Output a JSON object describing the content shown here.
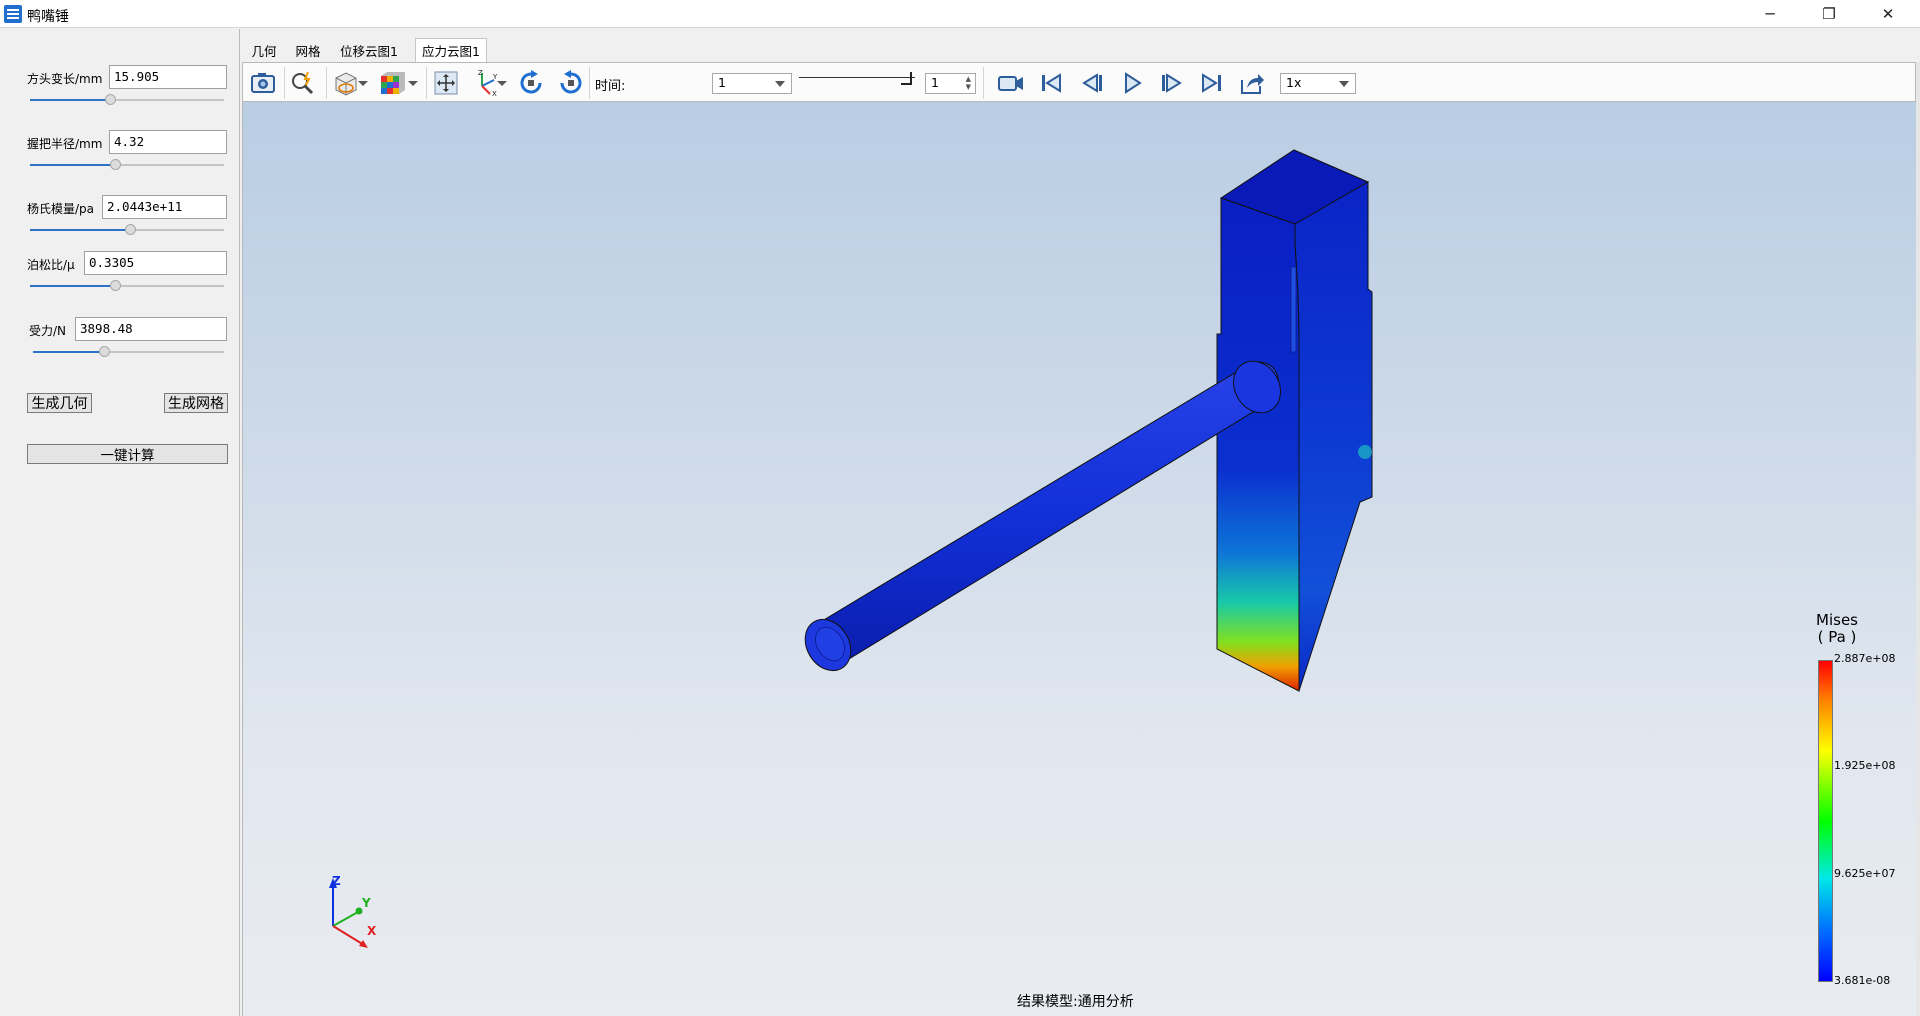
{
  "window": {
    "title": "鸭嘴锤",
    "min_glyph": "─",
    "max_glyph": "❐",
    "close_glyph": "✕"
  },
  "params": [
    {
      "label": "方头变长/mm",
      "value": "15.905",
      "slider_fraction": 0.45
    },
    {
      "label": "握把半径/mm",
      "value": "4.32",
      "slider_fraction": 0.45
    },
    {
      "label": "杨氏模量/pa",
      "value": "2.0443e+11",
      "slider_fraction": 0.52
    },
    {
      "label": "泊松比/μ",
      "value": "0.3305",
      "slider_fraction": 0.45
    },
    {
      "label": "受力/N",
      "value": "3898.48",
      "slider_fraction": 0.38
    }
  ],
  "buttons": {
    "gen_geometry": "生成几何",
    "gen_mesh": "生成网格",
    "compute": "一键计算"
  },
  "tabs": [
    {
      "label": "几何",
      "active": false
    },
    {
      "label": "网格",
      "active": false
    },
    {
      "label": "位移云图1",
      "active": false
    },
    {
      "label": "应力云图1",
      "active": true
    }
  ],
  "toolbar": {
    "time_label": "时间:",
    "time_value": "1",
    "frame_value": "1",
    "speed_value": "1x"
  },
  "legend": {
    "title_line1": "Mises",
    "title_line2": "( Pa )",
    "max": "2.887e+08",
    "mid_high": "1.925e+08",
    "mid_low": "9.625e+07",
    "min": "3.681e-08"
  },
  "axes": {
    "z": "Z",
    "y": "Y",
    "x": "X"
  },
  "status": "结果模型:通用分析",
  "colors": {
    "accent": "#2d74c8",
    "model_blue": "#0a22c8"
  }
}
